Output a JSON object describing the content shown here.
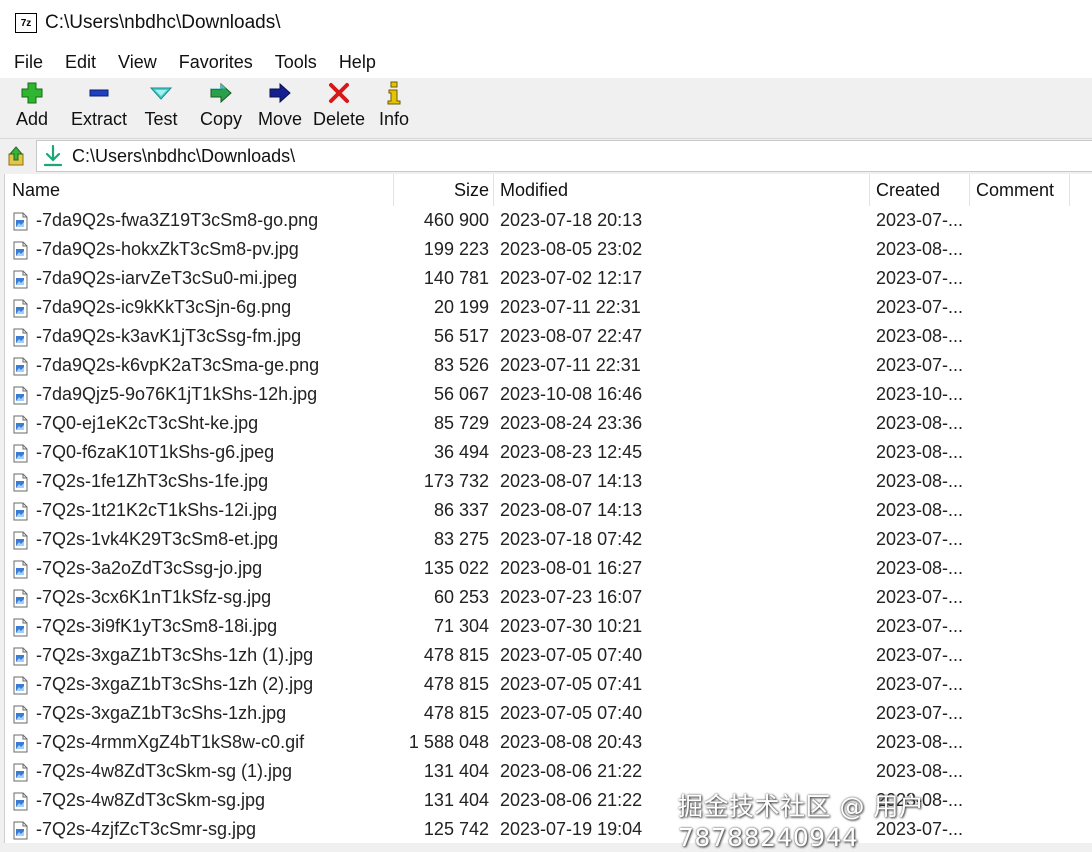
{
  "window": {
    "title": "C:\\Users\\nbdhc\\Downloads\\",
    "app_icon_text": "7z"
  },
  "menu": [
    "File",
    "Edit",
    "View",
    "Favorites",
    "Tools",
    "Help"
  ],
  "toolbar": [
    {
      "label": "Add",
      "icon": "add-icon"
    },
    {
      "label": "Extract",
      "icon": "extract-icon"
    },
    {
      "label": "Test",
      "icon": "test-icon"
    },
    {
      "label": "Copy",
      "icon": "copy-icon"
    },
    {
      "label": "Move",
      "icon": "move-icon"
    },
    {
      "label": "Delete",
      "icon": "delete-icon"
    },
    {
      "label": "Info",
      "icon": "info-icon"
    }
  ],
  "address": {
    "path": "C:\\Users\\nbdhc\\Downloads\\"
  },
  "columns": {
    "name": "Name",
    "size": "Size",
    "modified": "Modified",
    "created": "Created",
    "comment": "Comment"
  },
  "files": [
    {
      "name": "-7da9Q2s-fwa3Z19T3cSm8-go.png",
      "size": "460 900",
      "modified": "2023-07-18 20:13",
      "created": "2023-07-..."
    },
    {
      "name": "-7da9Q2s-hokxZkT3cSm8-pv.jpg",
      "size": "199 223",
      "modified": "2023-08-05 23:02",
      "created": "2023-08-..."
    },
    {
      "name": "-7da9Q2s-iarvZeT3cSu0-mi.jpeg",
      "size": "140 781",
      "modified": "2023-07-02 12:17",
      "created": "2023-07-..."
    },
    {
      "name": "-7da9Q2s-ic9kKkT3cSjn-6g.png",
      "size": "20 199",
      "modified": "2023-07-11 22:31",
      "created": "2023-07-..."
    },
    {
      "name": "-7da9Q2s-k3avK1jT3cSsg-fm.jpg",
      "size": "56 517",
      "modified": "2023-08-07 22:47",
      "created": "2023-08-..."
    },
    {
      "name": "-7da9Q2s-k6vpK2aT3cSma-ge.png",
      "size": "83 526",
      "modified": "2023-07-11 22:31",
      "created": "2023-07-..."
    },
    {
      "name": "-7da9Qjz5-9o76K1jT1kShs-12h.jpg",
      "size": "56 067",
      "modified": "2023-10-08 16:46",
      "created": "2023-10-..."
    },
    {
      "name": "-7Q0-ej1eK2cT3cSht-ke.jpg",
      "size": "85 729",
      "modified": "2023-08-24 23:36",
      "created": "2023-08-..."
    },
    {
      "name": "-7Q0-f6zaK10T1kShs-g6.jpeg",
      "size": "36 494",
      "modified": "2023-08-23 12:45",
      "created": "2023-08-..."
    },
    {
      "name": "-7Q2s-1fe1ZhT3cShs-1fe.jpg",
      "size": "173 732",
      "modified": "2023-08-07 14:13",
      "created": "2023-08-..."
    },
    {
      "name": "-7Q2s-1t21K2cT1kShs-12i.jpg",
      "size": "86 337",
      "modified": "2023-08-07 14:13",
      "created": "2023-08-..."
    },
    {
      "name": "-7Q2s-1vk4K29T3cSm8-et.jpg",
      "size": "83 275",
      "modified": "2023-07-18 07:42",
      "created": "2023-07-..."
    },
    {
      "name": "-7Q2s-3a2oZdT3cSsg-jo.jpg",
      "size": "135 022",
      "modified": "2023-08-01 16:27",
      "created": "2023-08-..."
    },
    {
      "name": "-7Q2s-3cx6K1nT1kSfz-sg.jpg",
      "size": "60 253",
      "modified": "2023-07-23 16:07",
      "created": "2023-07-..."
    },
    {
      "name": "-7Q2s-3i9fK1yT3cSm8-18i.jpg",
      "size": "71 304",
      "modified": "2023-07-30 10:21",
      "created": "2023-07-..."
    },
    {
      "name": "-7Q2s-3xgaZ1bT3cShs-1zh (1).jpg",
      "size": "478 815",
      "modified": "2023-07-05 07:40",
      "created": "2023-07-..."
    },
    {
      "name": "-7Q2s-3xgaZ1bT3cShs-1zh (2).jpg",
      "size": "478 815",
      "modified": "2023-07-05 07:41",
      "created": "2023-07-..."
    },
    {
      "name": "-7Q2s-3xgaZ1bT3cShs-1zh.jpg",
      "size": "478 815",
      "modified": "2023-07-05 07:40",
      "created": "2023-07-..."
    },
    {
      "name": "-7Q2s-4rmmXgZ4bT1kS8w-c0.gif",
      "size": "1 588 048",
      "modified": "2023-08-08 20:43",
      "created": "2023-08-..."
    },
    {
      "name": "-7Q2s-4w8ZdT3cSkm-sg (1).jpg",
      "size": "131 404",
      "modified": "2023-08-06 21:22",
      "created": "2023-08-..."
    },
    {
      "name": "-7Q2s-4w8ZdT3cSkm-sg.jpg",
      "size": "131 404",
      "modified": "2023-08-06 21:22",
      "created": "2023-08-..."
    },
    {
      "name": "-7Q2s-4zjfZcT3cSmr-sg.jpg",
      "size": "125 742",
      "modified": "2023-07-19 19:04",
      "created": "2023-07-..."
    }
  ],
  "watermark": "掘金技术社区 @ 用户78788240944"
}
